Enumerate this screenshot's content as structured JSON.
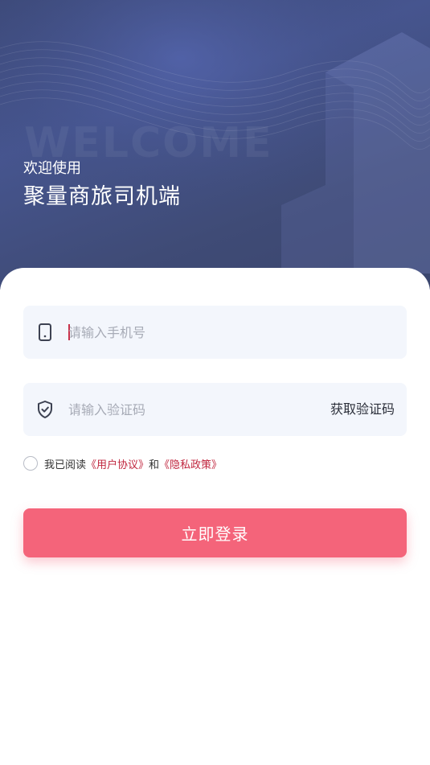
{
  "hero": {
    "watermark": "WELCOME",
    "subtitle": "欢迎使用",
    "title": "聚量商旅司机端"
  },
  "form": {
    "phone": {
      "placeholder": "请输入手机号",
      "icon": "phone-icon"
    },
    "code": {
      "placeholder": "请输入验证码",
      "icon": "shield-check-icon",
      "get_code_label": "获取验证码"
    },
    "agreement": {
      "prefix": "我已阅读",
      "user_agreement": "《用户协议》",
      "and": "和",
      "privacy_policy": "《隐私政策》",
      "checked": false
    },
    "login_label": "立即登录"
  },
  "colors": {
    "hero_bg": "#46558f",
    "accent": "#f4647a",
    "link": "#c0263e",
    "field_bg": "#f3f6fc"
  }
}
